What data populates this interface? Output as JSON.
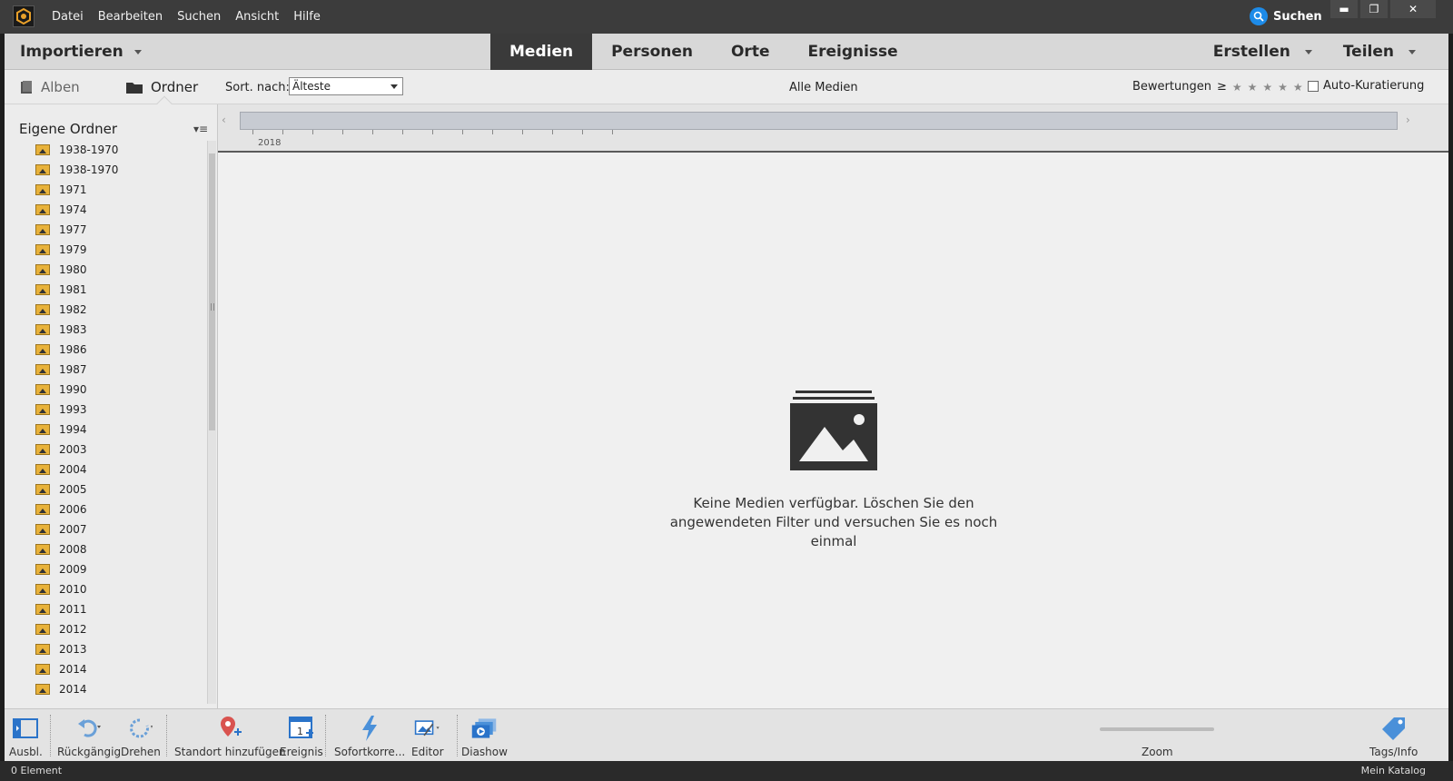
{
  "menu": [
    "Datei",
    "Bearbeiten",
    "Suchen",
    "Ansicht",
    "Hilfe"
  ],
  "search_button": "Suchen",
  "window_controls": {
    "minimize": "▬",
    "restore": "❐",
    "close": "✕"
  },
  "nav": {
    "import": "Importieren",
    "tabs": [
      "Medien",
      "Personen",
      "Orte",
      "Ereignisse"
    ],
    "active_tab": "Medien",
    "create": "Erstellen",
    "share": "Teilen"
  },
  "left_panel": {
    "tab_albums": "Alben",
    "tab_folders": "Ordner",
    "title": "Eigene Ordner",
    "options_icon": "▾≡",
    "folders": [
      "1938-1970",
      "1938-1970",
      "1971",
      "1974",
      "1977",
      "1979",
      "1980",
      "1981",
      "1982",
      "1983",
      "1986",
      "1987",
      "1990",
      "1993",
      "1994",
      "2003",
      "2004",
      "2005",
      "2006",
      "2007",
      "2008",
      "2009",
      "2010",
      "2011",
      "2012",
      "2013",
      "2014",
      "2014"
    ]
  },
  "subbar": {
    "sort_label": "Sort. nach:",
    "sort_value": "Älteste",
    "all_media": "Alle Medien",
    "ratings_label": "Bewertungen",
    "ratings_op": "≥",
    "stars": "★★★★★",
    "auto_curation": "Auto-Kuratierung"
  },
  "timeline": {
    "year": "2018"
  },
  "empty_state": {
    "message": "Keine Medien verfügbar. Löschen Sie den angewendeten Filter und versuchen Sie es noch einmal"
  },
  "bottom_tools": {
    "hide": "Ausbl.",
    "undo": "Rückgängig",
    "rotate": "Drehen",
    "add_location": "Standort hinzufügen",
    "event": "Ereignis",
    "quickfix": "Sofortkorre...",
    "editor": "Editor",
    "slideshow": "Diashow",
    "zoom": "Zoom",
    "tags_info": "Tags/Info"
  },
  "status": {
    "left": "0 Element",
    "right": "Mein Katalog"
  },
  "colors": {
    "titlebar": "#3c3c3c",
    "nav_active": "#3a3a3a",
    "accent_blue": "#1d8be8",
    "content_bg": "#f0f0f0"
  }
}
